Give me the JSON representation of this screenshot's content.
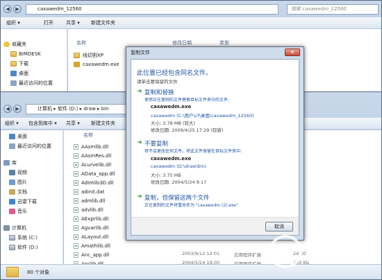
{
  "back_window": {
    "address": "caxawedm_12560",
    "search_placeholder": "搜索 caxawedm_12560",
    "toolbar": {
      "organize": "组织 ▾",
      "open": "打开",
      "share": "共享 ▾",
      "new_folder": "新建文件夹"
    },
    "sidebar": [
      "收藏夹",
      "BIMDESK",
      "下载",
      "桌面",
      "最近访问的位置"
    ],
    "columns": {
      "name": "名称",
      "modified": "修改日期",
      "type": "类型"
    },
    "files": [
      "线切割XP",
      "caxawedm.exe"
    ]
  },
  "front_window": {
    "address": {
      "computer": "计算机",
      "drive": "软件 (D:)",
      "draw": "draw",
      "bin": "bin"
    },
    "toolbar": {
      "organize": "组织 ▾",
      "include": "包含到库中 ▾",
      "share": "共享 ▾",
      "new_folder": "新建文件夹"
    },
    "sidebar": [
      {
        "label": "桌面",
        "icon": "desktop-icon"
      },
      {
        "label": "最近访问的位置",
        "icon": "recent-icon"
      },
      {
        "label": "库",
        "icon": "library-icon"
      },
      {
        "label": "视频",
        "icon": "video-icon"
      },
      {
        "label": "图片",
        "icon": "picture-icon"
      },
      {
        "label": "文档",
        "icon": "document-icon"
      },
      {
        "label": "迅雷下载",
        "icon": "download-icon"
      },
      {
        "label": "音乐",
        "icon": "music-icon"
      },
      {
        "label": "计算机",
        "icon": "computer-icon"
      },
      {
        "label": "系统 (C:)",
        "icon": "drive-icon"
      },
      {
        "label": "软件 (D:)",
        "icon": "drive-icon"
      },
      {
        "label": "网络",
        "icon": "network-icon"
      }
    ],
    "column_name": "名称",
    "files": [
      "AAsmlib.dll",
      "AAsmRes.dll",
      "Acurvelib.dll",
      "AData_app.dll",
      "Adimlib3D.dll",
      "adinit.dat",
      "admlib.dll",
      "advlib.dll",
      "AExprlib.dll",
      "Agvarlib.dll",
      "ALayout.dll",
      "Amathlib.dll",
      "Anc_app.dll",
      "Anclib.dll"
    ],
    "meta_rows": [
      {
        "date": "2003/9/12 12:01",
        "type": "应用程序扩展",
        "size": "24 KB"
      },
      {
        "date": "2004/5/24 19:00",
        "type": "应用程序扩展",
        "size": "100 KB"
      }
    ],
    "status": "80 个对象"
  },
  "dialog": {
    "title": "复制文件",
    "close": "✕",
    "heading": "此位置已经包含同名文件。",
    "subheading": "请单击要保留的文件",
    "option1": {
      "title": "复制和替换",
      "desc": "使用正在复制的文件替换目标文件夹中的文件:",
      "file": "caxawedm.exe",
      "path": "caxawedm (C:\\用户\\cf\\桌面\\caxawedm_12560)",
      "size": "大小: 3.78 MB (较大)",
      "date": "修改日期: 2009/4/25 17:29 (较新)"
    },
    "option2": {
      "title": "不要复制",
      "desc": "将不会更改任何文件。将此文件保留在目标文件夹中:",
      "file": "caxawedm.exe",
      "path": "caxawedm (D:\\draw\\bin)",
      "size": "大小: 3.75 MB",
      "date": "修改日期: 2004/5/24 9:17"
    },
    "option3": {
      "title": "复制，但保留这两个文件",
      "desc": "正在复制的文件将重命名为 \"caxawedm (2).exe\""
    },
    "cancel": "取消"
  },
  "watermark": {
    "brand": "当下软件园",
    "url": "www.downxia.com"
  }
}
